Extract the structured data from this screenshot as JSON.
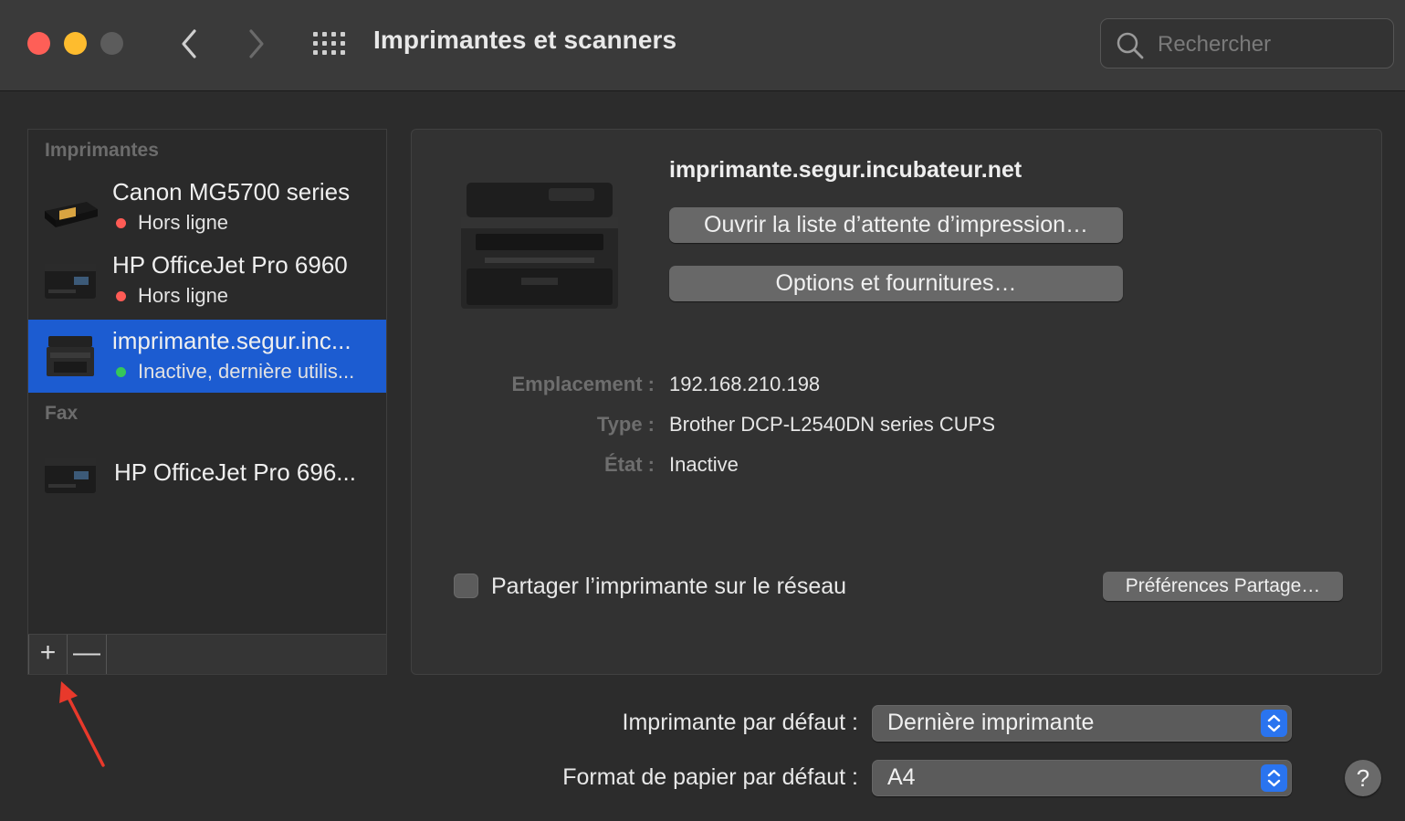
{
  "window": {
    "title": "Imprimantes et scanners",
    "search_placeholder": "Rechercher"
  },
  "sidebar": {
    "printers_header": "Imprimantes",
    "fax_header": "Fax",
    "printers": [
      {
        "name": "Canon MG5700 series",
        "status": "Hors ligne",
        "status_color": "#ff5b55"
      },
      {
        "name": "HP OfficeJet Pro 6960",
        "status": "Hors ligne",
        "status_color": "#ff5b55"
      },
      {
        "name": "imprimante.segur.inc...",
        "status": "Inactive, dernière utilis...",
        "status_color": "#35c759"
      }
    ],
    "fax": [
      {
        "name": "HP OfficeJet Pro 696..."
      }
    ],
    "add_label": "+",
    "remove_label": "—"
  },
  "detail": {
    "title": "imprimante.segur.incubateur.net",
    "queue_button": "Ouvrir la liste d’attente d’impression…",
    "options_button": "Options et fournitures…",
    "location_label": "Emplacement :",
    "location_value": "192.168.210.198",
    "type_label": "Type :",
    "type_value": "Brother DCP-L2540DN series CUPS",
    "state_label": "État :",
    "state_value": "Inactive",
    "share_label": "Partager l’imprimante sur le réseau",
    "share_checked": false,
    "share_prefs_button": "Préférences Partage…"
  },
  "defaults": {
    "printer_label": "Imprimante par défaut :",
    "printer_value": "Dernière imprimante",
    "paper_label": "Format de papier par défaut :",
    "paper_value": "A4"
  },
  "help_label": "?",
  "colors": {
    "accent": "#1c5cd1",
    "stepper": "#2a74ef",
    "annotation_arrow": "#e8392b"
  }
}
